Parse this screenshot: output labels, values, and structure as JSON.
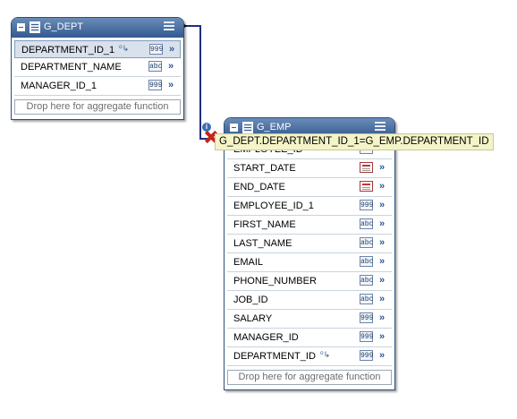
{
  "g_dept": {
    "title": "G_DEPT",
    "rows": [
      {
        "name": "DEPARTMENT_ID_1",
        "type": "999",
        "key": true
      },
      {
        "name": "DEPARTMENT_NAME",
        "type": "abc"
      },
      {
        "name": "MANAGER_ID_1",
        "type": "999"
      }
    ],
    "drop_label": "Drop here for aggregate function"
  },
  "g_emp": {
    "title": "G_EMP",
    "rows": [
      {
        "name": "EMPLOYEE_ID",
        "type": "999"
      },
      {
        "name": "START_DATE",
        "type": "date"
      },
      {
        "name": "END_DATE",
        "type": "date"
      },
      {
        "name": "EMPLOYEE_ID_1",
        "type": "999"
      },
      {
        "name": "FIRST_NAME",
        "type": "abc"
      },
      {
        "name": "LAST_NAME",
        "type": "abc"
      },
      {
        "name": "EMAIL",
        "type": "abc"
      },
      {
        "name": "PHONE_NUMBER",
        "type": "abc"
      },
      {
        "name": "JOB_ID",
        "type": "abc"
      },
      {
        "name": "SALARY",
        "type": "999"
      },
      {
        "name": "MANAGER_ID",
        "type": "999"
      },
      {
        "name": "DEPARTMENT_ID",
        "type": "999",
        "key": true
      }
    ],
    "drop_label": "Drop here for aggregate function"
  },
  "join_tooltip": "G_DEPT.DEPARTMENT_ID_1=G_EMP.DEPARTMENT_ID",
  "icons": {
    "collapse": "collapse-icon",
    "table": "table-icon",
    "menu": "menu-icon",
    "key": "key-icon",
    "map": "map-arrow-icon",
    "remove": "remove-link-icon",
    "info": "info-icon"
  },
  "colors": {
    "header_top": "#6a8cb8",
    "header_bottom": "#33598f",
    "join_line": "#1f2f7f",
    "tooltip_bg": "#f4f4c8"
  }
}
